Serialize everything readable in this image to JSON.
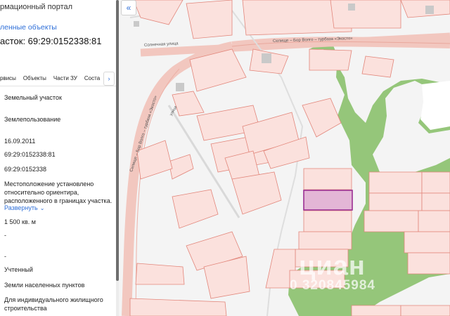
{
  "panel": {
    "portal_title": "рмационный портал",
    "selected_objects_link": "ленные объекты",
    "cadastral_number_heading": "асток: 69:29:0152338:81",
    "tabs": [
      {
        "label": "рвисы"
      },
      {
        "label": "Объекты"
      },
      {
        "label": "Части ЗУ"
      },
      {
        "label": "Соста"
      }
    ],
    "tabs_next_label": "›",
    "fields": [
      {
        "value": "Земельный участок"
      },
      {
        "value": "Землепользование"
      },
      {
        "value": "16.09.2011"
      },
      {
        "value": "69:29:0152338:81"
      },
      {
        "value": "69:29:0152338"
      },
      {
        "value": "Местоположение установлено относительно ориентира, расположенного в границах участка."
      },
      {
        "value": "1 500 кв. м"
      },
      {
        "value": "-"
      },
      {
        "value": "-"
      },
      {
        "value": "Учтенный"
      },
      {
        "value": "Земли населенных пунктов"
      },
      {
        "value": "Для индивидуального жилищного строительства"
      }
    ],
    "expand_link": "Развернуть",
    "expand_icon": "chevron-down-icon"
  },
  "map": {
    "collapse_button": "«",
    "road_labels": {
      "solnechnaya": "Солнечная улица",
      "road_top": "Селище – Бор Волго – турбаза «Экосто»",
      "road_diagonal": "Селище – Бор Волго – турбаза «Экосто»",
      "vertical_street": "улица"
    },
    "watermark": "циан",
    "watermark_phone": "0 320845984"
  },
  "colors": {
    "accent": "#2e6fd8",
    "parcel_fill": "#fbe1dd",
    "parcel_stroke": "#e2867b",
    "forest": "#95c67a",
    "selected_parcel": "#e3b6d6",
    "selected_stroke": "#9b2f93"
  }
}
